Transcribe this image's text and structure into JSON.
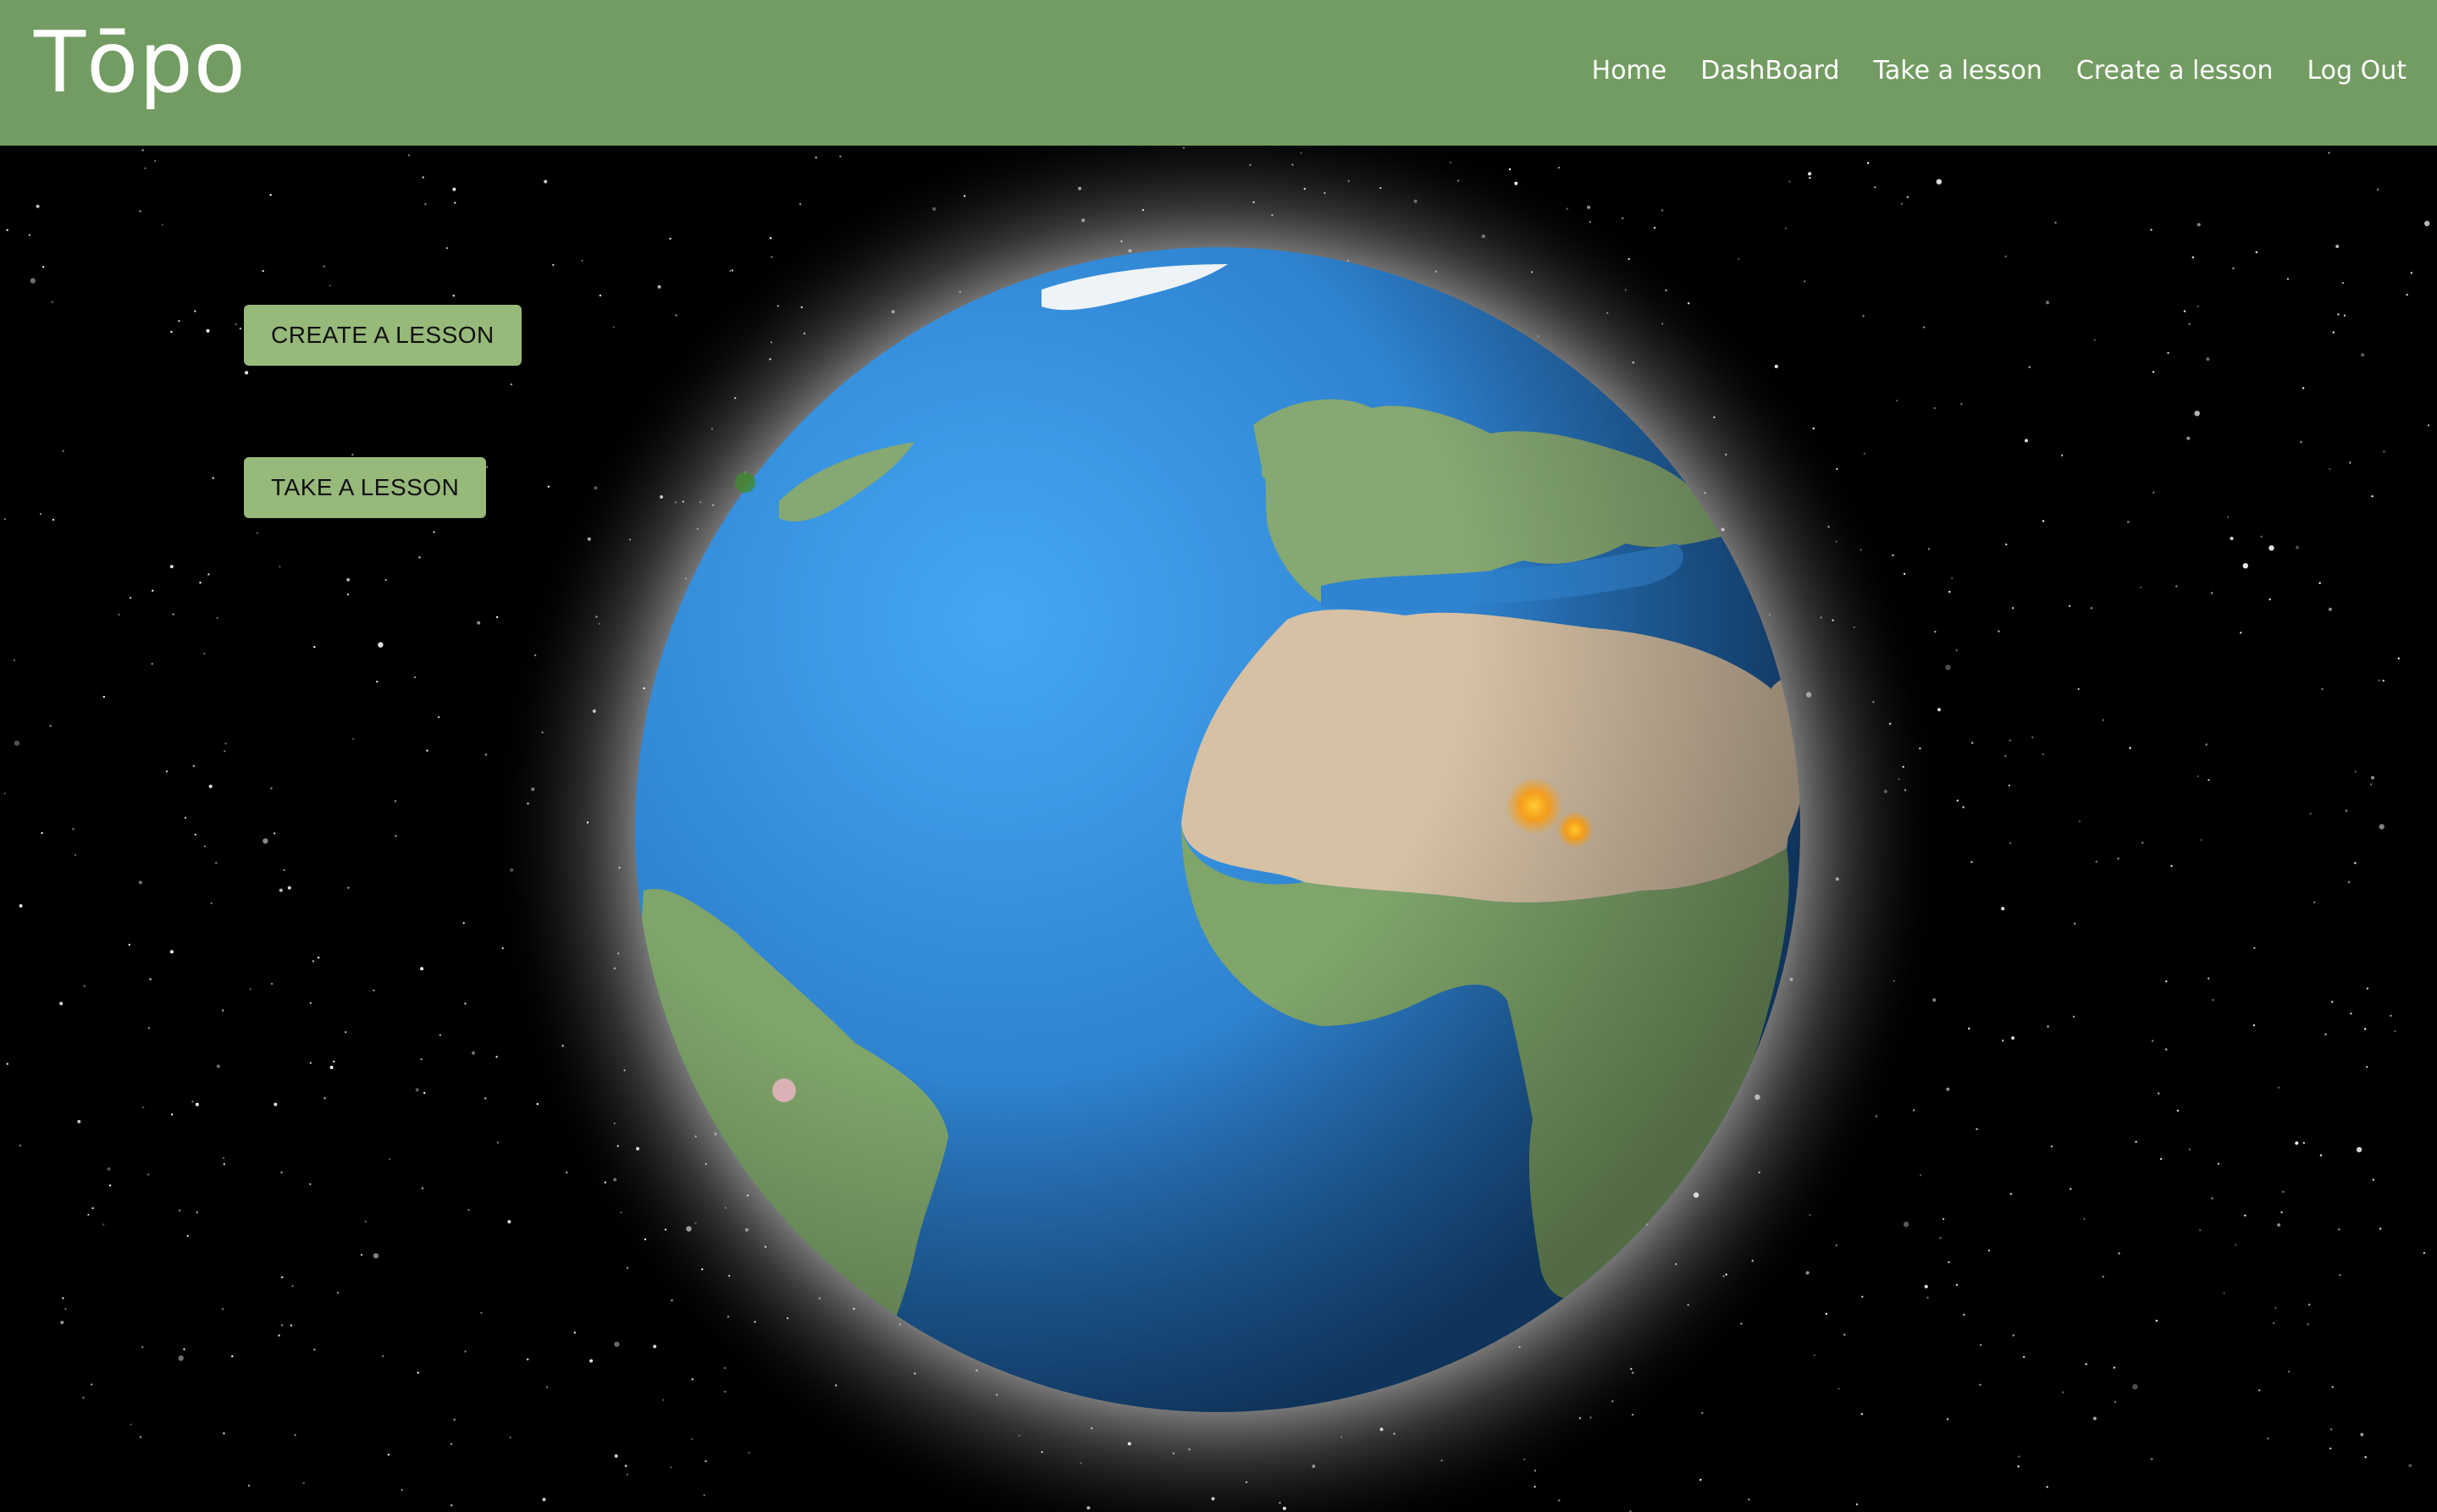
{
  "navbar": {
    "brand": "Tōpo",
    "links": [
      "Home",
      "DashBoard",
      "Take a lesson",
      "Create a lesson",
      "Log Out"
    ],
    "background_color": "#739c63"
  },
  "actions": {
    "create_label": "CREATE A LESSON",
    "take_label": "TAKE A LESSON",
    "button_color": "#97b97a"
  },
  "globe": {
    "ocean_color": "#2f86d6",
    "land_color": "#7fa56a",
    "desert_color": "#d9c4a8"
  }
}
